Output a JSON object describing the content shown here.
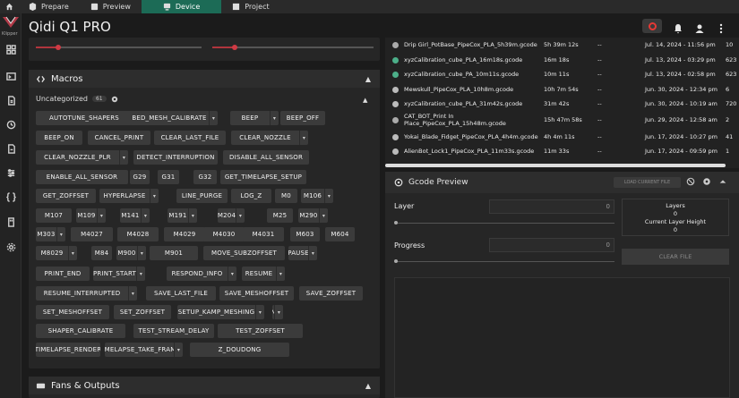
{
  "tabs": [
    {
      "label": "",
      "icon": "home-icon"
    },
    {
      "label": "Prepare",
      "icon": "prepare-icon"
    },
    {
      "label": "Preview",
      "icon": "preview-icon"
    },
    {
      "label": "Device",
      "icon": "device-icon",
      "active": true
    },
    {
      "label": "Project",
      "icon": "project-icon"
    }
  ],
  "brand": {
    "logo_text": "Klipper"
  },
  "header": {
    "printer_name": "Qidi Q1 PRO"
  },
  "colors": {
    "accent": "#1c6b56",
    "danger": "#e53935",
    "slider": "#d03a44"
  },
  "macros": {
    "title": "Macros",
    "group_label": "Uncategorized",
    "group_count": "61",
    "buttons": [
      {
        "label": "AUTOTUNE_SHAPERS",
        "dropdown": false
      },
      {
        "label": "BED_MESH_CALIBRATE",
        "dropdown": true
      },
      {
        "label": "BEEP",
        "dropdown": true
      },
      {
        "label": "BEEP_OFF",
        "dropdown": false
      },
      {
        "label": "BEEP_ON",
        "dropdown": false
      },
      {
        "label": "CANCEL_PRINT",
        "dropdown": false
      },
      {
        "label": "CLEAR_LAST_FILE",
        "dropdown": false
      },
      {
        "label": "CLEAR_NOZZLE",
        "dropdown": true
      },
      {
        "label": "CLEAR_NOZZLE_PLR",
        "dropdown": true
      },
      {
        "label": "DETECT_INTERRUPTION",
        "dropdown": false
      },
      {
        "label": "DISABLE_ALL_SENSOR",
        "dropdown": false
      },
      {
        "label": "ENABLE_ALL_SENSOR",
        "dropdown": false
      },
      {
        "label": "G29",
        "dropdown": false
      },
      {
        "label": "G31",
        "dropdown": false
      },
      {
        "label": "G32",
        "dropdown": false
      },
      {
        "label": "GET_TIMELAPSE_SETUP",
        "dropdown": false
      },
      {
        "label": "GET_ZOFFSET",
        "dropdown": false
      },
      {
        "label": "HYPERLAPSE",
        "dropdown": true
      },
      {
        "label": "LINE_PURGE",
        "dropdown": false
      },
      {
        "label": "LOG_Z",
        "dropdown": false
      },
      {
        "label": "M0",
        "dropdown": false
      },
      {
        "label": "M106",
        "dropdown": true
      },
      {
        "label": "M107",
        "dropdown": false
      },
      {
        "label": "M109",
        "dropdown": true
      },
      {
        "label": "M141",
        "dropdown": true
      },
      {
        "label": "M191",
        "dropdown": true
      },
      {
        "label": "M204",
        "dropdown": true
      },
      {
        "label": "M25",
        "dropdown": false
      },
      {
        "label": "M290",
        "dropdown": true
      },
      {
        "label": "M303",
        "dropdown": true
      },
      {
        "label": "M4027",
        "dropdown": false
      },
      {
        "label": "M4028",
        "dropdown": false
      },
      {
        "label": "M4029",
        "dropdown": false
      },
      {
        "label": "M4030",
        "dropdown": false
      },
      {
        "label": "M4031",
        "dropdown": false
      },
      {
        "label": "M603",
        "dropdown": false
      },
      {
        "label": "M604",
        "dropdown": false
      },
      {
        "label": "M8029",
        "dropdown": true
      },
      {
        "label": "M84",
        "dropdown": false
      },
      {
        "label": "M900",
        "dropdown": true
      },
      {
        "label": "M901",
        "dropdown": false
      },
      {
        "label": "MOVE_SUBZOFFSET",
        "dropdown": false
      },
      {
        "label": "PAUSE",
        "dropdown": true
      },
      {
        "label": "PRINT_END",
        "dropdown": false
      },
      {
        "label": "PRINT_START",
        "dropdown": true
      },
      {
        "label": "RESPOND_INFO",
        "dropdown": true
      },
      {
        "label": "RESUME",
        "dropdown": true
      },
      {
        "label": "RESUME_INTERRUPTED",
        "dropdown": true
      },
      {
        "label": "SAVE_LAST_FILE",
        "dropdown": false
      },
      {
        "label": "SAVE_MESHOFFSET",
        "dropdown": false
      },
      {
        "label": "SAVE_ZOFFSET",
        "dropdown": false
      },
      {
        "label": "SET_MESHOFFSET",
        "dropdown": false
      },
      {
        "label": "SET_ZOFFSET",
        "dropdown": false
      },
      {
        "label": "SETUP_KAMP_MESHING",
        "dropdown": true
      },
      {
        "label": "SETUP_LINE_PURGE",
        "dropdown": true
      },
      {
        "label": "SHAPER_CALIBRATE",
        "dropdown": false
      },
      {
        "label": "TEST_STREAM_DELAY",
        "dropdown": false
      },
      {
        "label": "TEST_ZOFFSET",
        "dropdown": false
      },
      {
        "label": "TIMELAPSE_RENDER",
        "dropdown": false
      },
      {
        "label": "TIMELAPSE_TAKE_FRAME",
        "dropdown": true
      },
      {
        "label": "Z_DOUDONG",
        "dropdown": false
      }
    ]
  },
  "fans": {
    "title": "Fans & Outputs"
  },
  "files": [
    {
      "name": "Drip Girl_PotBase_PipeCox_PLA_5h39m.gcode",
      "time": "5h 39m 12s",
      "dash": "--",
      "date": "Jul. 14, 2024 - 11:56 pm",
      "extra": "10"
    },
    {
      "name": "xyzCalibration_cube_PLA_16m18s.gcode",
      "time": "16m 18s",
      "dash": "--",
      "date": "Jul. 13, 2024 - 03:29 pm",
      "extra": "623"
    },
    {
      "name": "xyzCalibration_cube_PA_10m11s.gcode",
      "time": "10m 11s",
      "dash": "--",
      "date": "Jul. 13, 2024 - 02:58 pm",
      "extra": "623"
    },
    {
      "name": "Mewskull_PipeCox_PLA_10h8m.gcode",
      "time": "10h 7m 54s",
      "dash": "--",
      "date": "Jun. 30, 2024 - 12:34 pm",
      "extra": "6"
    },
    {
      "name": "xyzCalibration_cube_PLA_31m42s.gcode",
      "time": "31m 42s",
      "dash": "--",
      "date": "Jun. 30, 2024 - 10:19 am",
      "extra": "720"
    },
    {
      "name": "CAT_BOT_Print In Place_PipeCox_PLA_15h48m.gcode",
      "time": "15h 47m 58s",
      "dash": "--",
      "date": "Jun. 29, 2024 - 12:58 am",
      "extra": "2"
    },
    {
      "name": "Yokai_Blade_Fidget_PipeCox_PLA_4h4m.gcode",
      "time": "4h 4m 11s",
      "dash": "--",
      "date": "Jun. 17, 2024 - 10:27 pm",
      "extra": "41"
    },
    {
      "name": "AlienBot_Lock1_PipeCox_PLA_11m33s.gcode",
      "time": "11m 33s",
      "dash": "--",
      "date": "Jun. 17, 2024 - 09:59 pm",
      "extra": "1"
    }
  ],
  "gcode": {
    "title": "Gcode Preview",
    "load_label": "LOAD CURRENT FILE",
    "layer_label": "Layer",
    "layer_value": "0",
    "progress_label": "Progress",
    "progress_value": "0",
    "stats_layers_label": "Layers",
    "stats_layers_value": "0",
    "stats_height_label": "Current Layer Height",
    "stats_height_value": "0",
    "clear_label": "CLEAR FILE"
  }
}
